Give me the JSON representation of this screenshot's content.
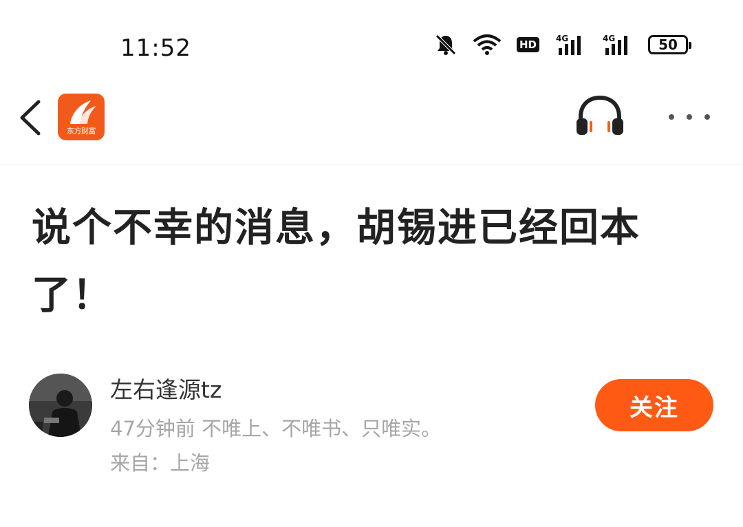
{
  "status_bar": {
    "time": "11:52",
    "hd_label": "HD",
    "signal_1": "4G",
    "signal_2": "4G",
    "battery": "50",
    "icons": [
      "bell-off-icon",
      "wifi-icon",
      "hd-icon",
      "signal-4g-icon",
      "signal-4g-icon",
      "battery-icon"
    ]
  },
  "nav": {
    "back_icon": "chevron-left-icon",
    "app_logo_text": "东方财富",
    "headphone_icon": "headphone-icon",
    "more_icon": "more-dots-icon"
  },
  "article": {
    "title": "说个不幸的消息，胡锡进已经回本了！"
  },
  "author": {
    "name": "左右逢源tz",
    "meta": "47分钟前 不唯上、不唯书、只唯实。",
    "location": "来自：上海",
    "follow_label": "关注"
  },
  "colors": {
    "accent": "#ff5a14",
    "logo_bg": "#f25a1c",
    "secondary_text": "#a6a6a6"
  }
}
